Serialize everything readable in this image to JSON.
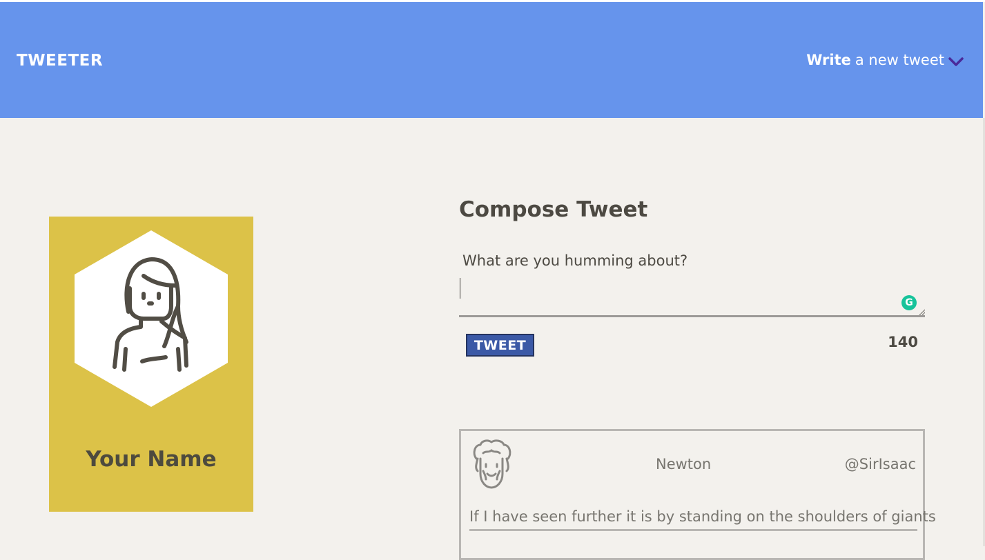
{
  "navbar": {
    "brand": "TWEETER",
    "compose_strong": "Write",
    "compose_light": "a new tweet",
    "chevron_icon": "chevron-down-icon",
    "background": "#6694ec",
    "chevron_color": "#4a2a9a"
  },
  "profile": {
    "name": "Your Name",
    "avatar_icon": "user-avatar-icon",
    "background": "#dcc248"
  },
  "compose": {
    "title": "Compose Tweet",
    "label": "What are you humming about?",
    "value": "",
    "grammarly_icon": "grammarly-icon",
    "button_label": "TWEET",
    "counter": "140",
    "button_color": "#3b59a6"
  },
  "tweets": [
    {
      "avatar_icon": "newton-avatar-icon",
      "name": "Newton",
      "handle": "@SirIsaac",
      "text": "If I have seen further it is by standing on the shoulders of giants"
    }
  ]
}
